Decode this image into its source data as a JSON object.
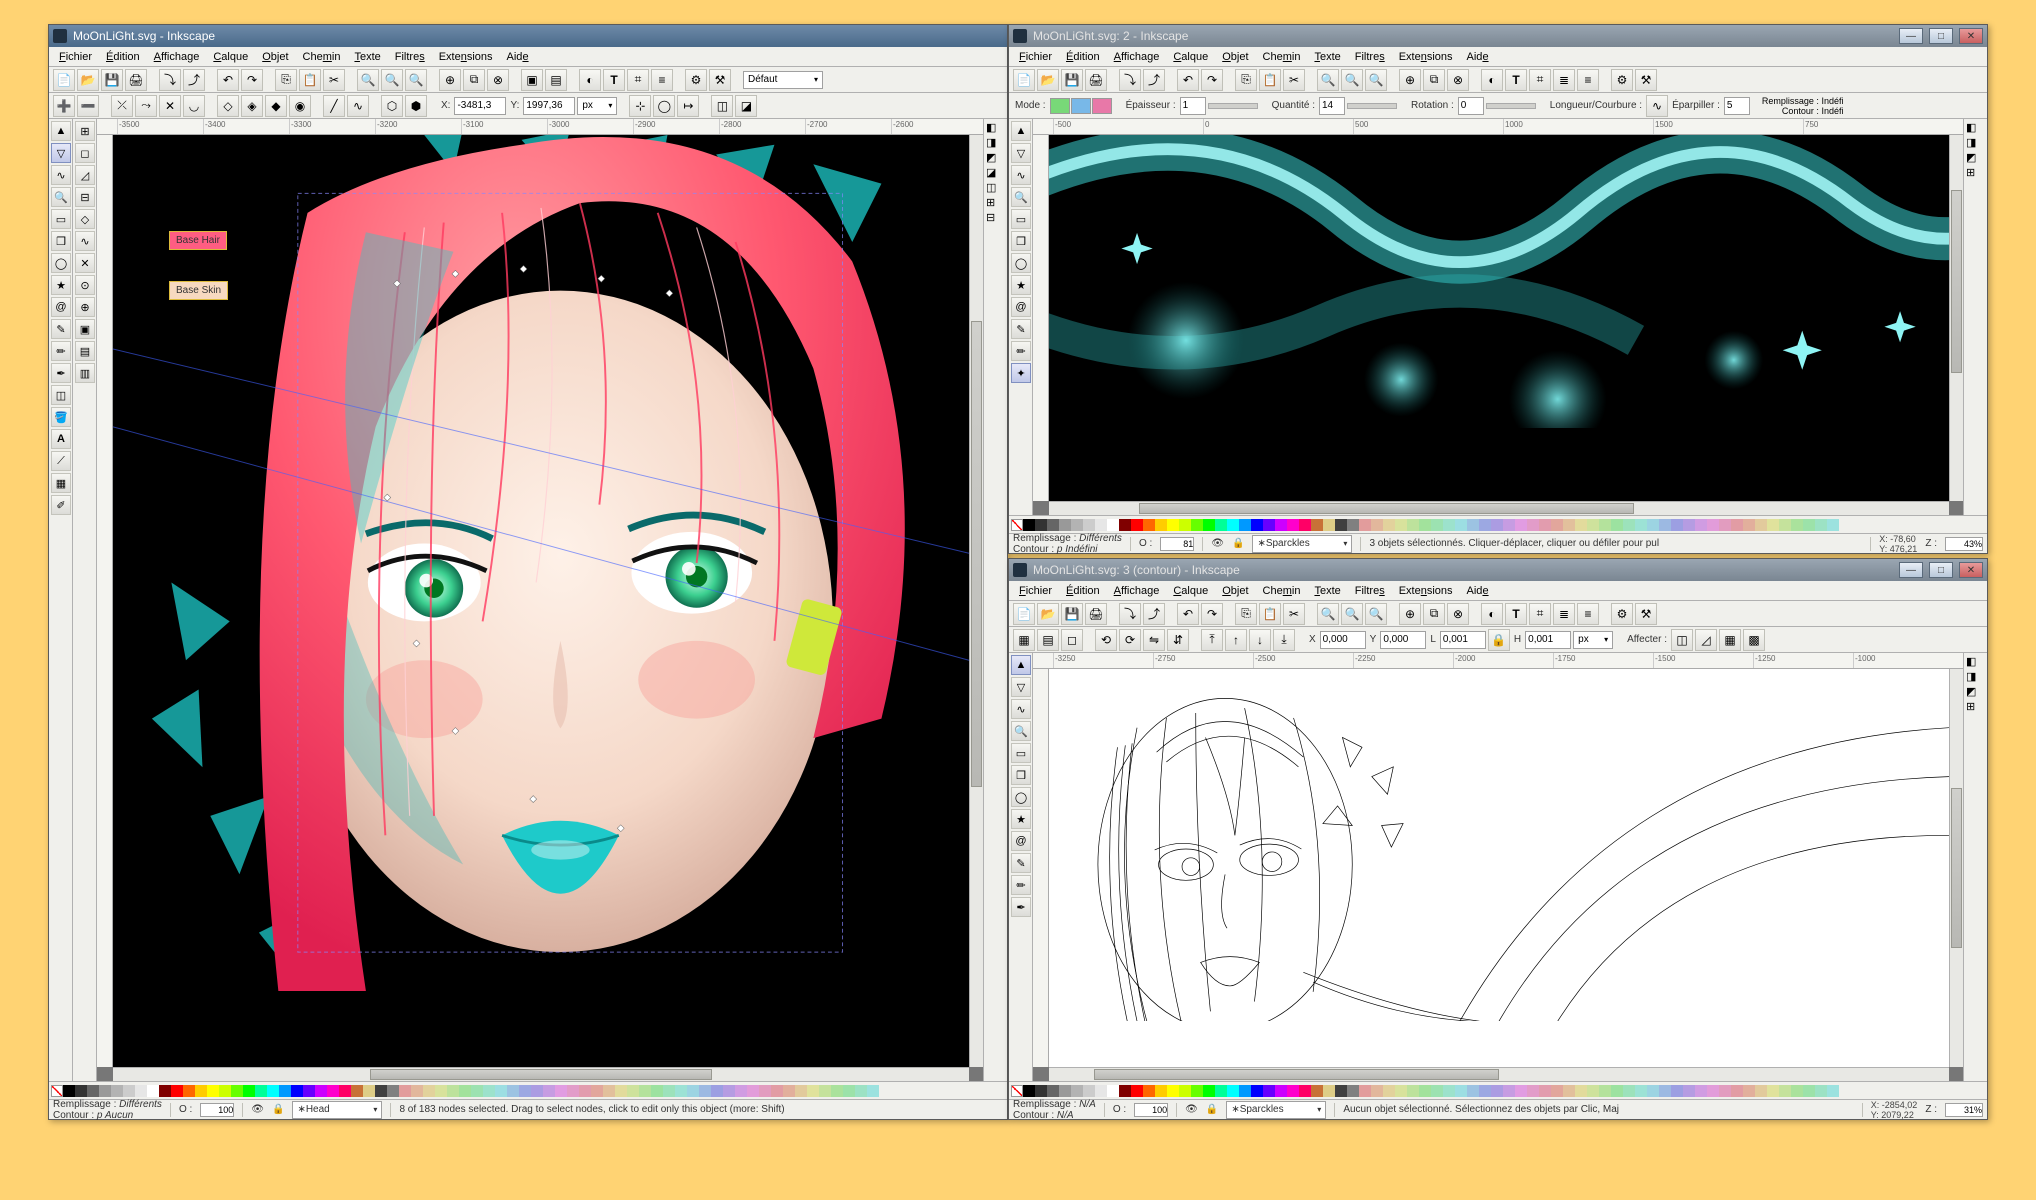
{
  "window1": {
    "title": "MoOnLiGht.svg - Inkscape",
    "menus": [
      "Fichier",
      "Édition",
      "Affichage",
      "Calque",
      "Objet",
      "Chemin",
      "Texte",
      "Filtres",
      "Extensions",
      "Aide"
    ],
    "layer_default": "Défaut",
    "coord": {
      "xlabel": "X:",
      "xval": "-3481,3",
      "ylabel": "Y:",
      "yval": "1997,36",
      "unit": "px"
    },
    "layers": {
      "base_hair": "Base Hair",
      "base_skin": "Base Skin"
    },
    "ruler_vals": [
      "-3500",
      "-3400",
      "-3300",
      "-3200",
      "-3100",
      "-3000",
      "-2900",
      "-2800",
      "-2700",
      "-2600"
    ],
    "status": {
      "fill_label": "Remplissage :",
      "fill_value": "Différents",
      "stroke_label": "Contour :",
      "stroke_value": "p Aucun",
      "opacity_label": "O :",
      "opacity_value": "100",
      "layer_name": "∗Head",
      "message": "8 of 183 nodes selected. Drag to select nodes, click to edit only this object (more: Shift)"
    }
  },
  "window2": {
    "title": "MoOnLiGht.svg: 2 - Inkscape",
    "menus": [
      "Fichier",
      "Édition",
      "Affichage",
      "Calque",
      "Objet",
      "Chemin",
      "Texte",
      "Filtres",
      "Extensions",
      "Aide"
    ],
    "controls": {
      "mode_label": "Mode :",
      "thickness_label": "Épaisseur :",
      "thickness": "1",
      "qty_label": "Quantité :",
      "qty": "14",
      "rot_label": "Rotation :",
      "rot": "0",
      "length_label": "Longueur/Courbure :",
      "scatter_label": "Éparpiller :",
      "scatter": "5",
      "fill_label": "Remplissage :",
      "fill_value": "Indéfi",
      "stroke_label": "Contour :",
      "stroke_value": "Indéfi"
    },
    "ruler_vals": [
      "-500",
      "0",
      "500",
      "1000",
      "1500",
      "750"
    ],
    "status": {
      "fill_label": "Remplissage :",
      "fill_value": "Différents",
      "stroke_label": "Contour :",
      "stroke_value": "p Indéfini",
      "opacity_label": "O :",
      "opacity_value": "81",
      "layer_name": "∗Sparckles",
      "message": "3 objets sélectionnés. Cliquer-déplacer, cliquer ou défiler pour pul",
      "coord_x": "X: -78,60",
      "coord_y": "Y: 476,21",
      "zoom_label": "Z :",
      "zoom_value": "43%"
    }
  },
  "window3": {
    "title": "MoOnLiGht.svg: 3 (contour) - Inkscape",
    "menus": [
      "Fichier",
      "Édition",
      "Affichage",
      "Calque",
      "Objet",
      "Chemin",
      "Texte",
      "Filtres",
      "Extensions",
      "Aide"
    ],
    "controls": {
      "xlabel": "X",
      "xval": "0,000",
      "ylabel": "Y",
      "yval": "0,000",
      "llabel": "L",
      "lval": "0,001",
      "hlabel": "H",
      "hval": "0,001",
      "unit": "px",
      "affect": "Affecter :"
    },
    "ruler_vals": [
      "-3250",
      "-2750",
      "-2500",
      "-2250",
      "-2000",
      "-1750",
      "-1500",
      "-1250",
      "-1000"
    ],
    "status": {
      "fill_label": "Remplissage :",
      "fill_value": "N/A",
      "stroke_label": "Contour :",
      "stroke_value": "N/A",
      "opacity_label": "O :",
      "opacity_value": "100",
      "layer_name": "∗Sparckles",
      "message": "Aucun objet sélectionné. Sélectionnez des objets par Clic, Maj",
      "coord_x": "X: -2854,02",
      "coord_y": "Y: 2079,22",
      "zoom_label": "Z :",
      "zoom_value": "31%"
    }
  },
  "palette": [
    "#000000",
    "#333333",
    "#666666",
    "#999999",
    "#b3b3b3",
    "#cccccc",
    "#e6e6e6",
    "#ffffff",
    "#800000",
    "#ff0000",
    "#ff6600",
    "#ffcc00",
    "#ffff00",
    "#ccff00",
    "#66ff00",
    "#00ff00",
    "#00ff99",
    "#00ffff",
    "#0099ff",
    "#0000ff",
    "#6600ff",
    "#cc00ff",
    "#ff00cc",
    "#ff0066",
    "#c87137",
    "#decd87",
    "#404040",
    "#808080"
  ]
}
